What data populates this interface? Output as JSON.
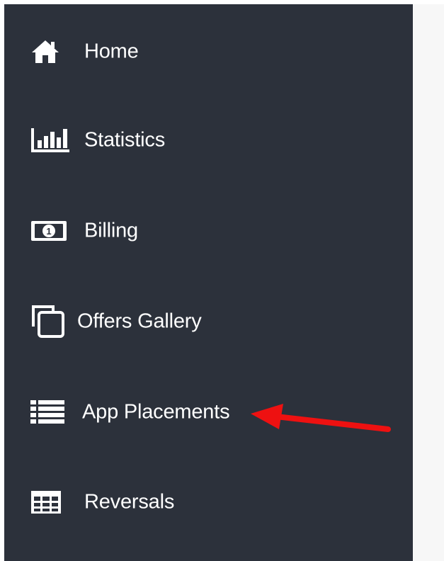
{
  "colors": {
    "sidebar_bg": "#2c313b",
    "content_bg": "#f7f7f7",
    "text": "#ffffff",
    "annotation_arrow": "#ee1111"
  },
  "sidebar": {
    "items": [
      {
        "label": "Home",
        "icon": "home-icon"
      },
      {
        "label": "Statistics",
        "icon": "bar-chart-icon"
      },
      {
        "label": "Billing",
        "icon": "money-icon"
      },
      {
        "label": "Offers Gallery",
        "icon": "clone-icon"
      },
      {
        "label": "App Placements",
        "icon": "list-icon"
      },
      {
        "label": "Reversals",
        "icon": "table-icon"
      }
    ]
  },
  "annotation": {
    "type": "arrow",
    "target": "App Placements",
    "color": "#ee1111"
  }
}
